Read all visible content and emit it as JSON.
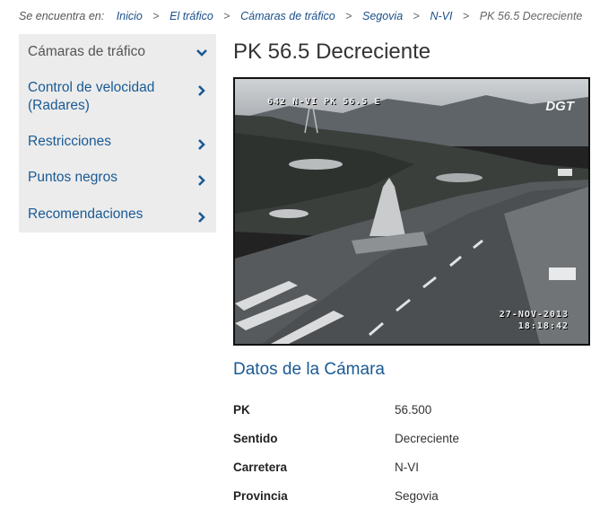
{
  "breadcrumb": {
    "prefix": "Se encuentra en:",
    "items": [
      "Inicio",
      "El tráfico",
      "Cámaras de tráfico",
      "Segovia",
      "N-VI"
    ],
    "current": "PK 56.5 Decreciente",
    "separator": ">"
  },
  "sidebar": {
    "items": [
      {
        "label": "Cámaras de tráfico",
        "icon": "chevron-down-icon"
      },
      {
        "label": "Control de velocidad (Radares)",
        "icon": "chevron-right-icon"
      },
      {
        "label": "Restricciones",
        "icon": "chevron-right-icon"
      },
      {
        "label": "Puntos negros",
        "icon": "chevron-right-icon"
      },
      {
        "label": "Recomendaciones",
        "icon": "chevron-right-icon"
      }
    ]
  },
  "main": {
    "title": "PK 56.5 Decreciente",
    "camera": {
      "overlay_id": "642 N-VI PK 56.5 E",
      "overlay_date": "27-NOV-2013",
      "overlay_time": "18:18:42",
      "logo": "DGT"
    },
    "section_title": "Datos de la Cámara",
    "fields": [
      {
        "label": "PK",
        "value": "56.500"
      },
      {
        "label": "Sentido",
        "value": "Decreciente"
      },
      {
        "label": "Carretera",
        "value": "N-VI"
      },
      {
        "label": "Provincia",
        "value": "Segovia"
      }
    ]
  },
  "colors": {
    "link": "#1a5a94",
    "sidebar_bg": "#ececec"
  }
}
